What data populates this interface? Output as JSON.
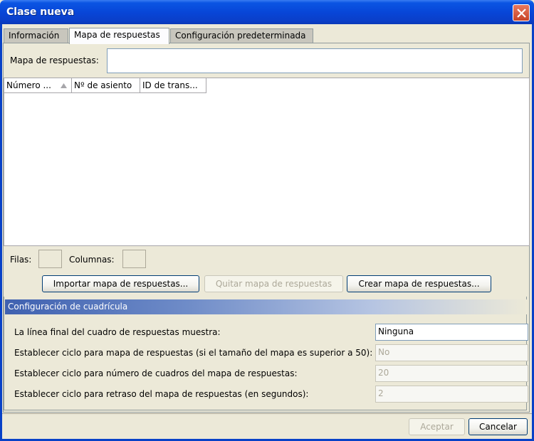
{
  "window": {
    "title": "Clase nueva"
  },
  "tabs": [
    {
      "label": "Información",
      "active": false
    },
    {
      "label": "Mapa de respuestas",
      "active": true
    },
    {
      "label": "Configuración predeterminada",
      "active": false
    }
  ],
  "answer_map": {
    "label": "Mapa de respuestas:",
    "value": ""
  },
  "table": {
    "columns": [
      "Número ...",
      "Nº de asiento",
      "ID de trans..."
    ],
    "sort_column": 0
  },
  "dimensions": {
    "rows_label": "Filas:",
    "rows_value": "",
    "cols_label": "Columnas:",
    "cols_value": ""
  },
  "actions": {
    "import": "Importar mapa de respuestas...",
    "remove": "Quitar mapa de respuestas",
    "create": "Crear mapa de respuestas..."
  },
  "grid_config": {
    "header": "Configuración de cuadrícula",
    "rows": [
      {
        "label": "La línea final del cuadro de respuestas muestra:",
        "value": "Ninguna",
        "enabled": true
      },
      {
        "label": "Establecer ciclo para mapa de respuestas (si el tamaño del mapa es superior a 50):",
        "value": "No",
        "enabled": false
      },
      {
        "label": "Establecer ciclo para número de cuadros del mapa de respuestas:",
        "value": "20",
        "enabled": false
      },
      {
        "label": "Establecer ciclo para retraso del mapa de respuestas (en segundos):",
        "value": "2",
        "enabled": false
      }
    ]
  },
  "footer": {
    "accept": "Aceptar",
    "cancel": "Cancelar"
  }
}
